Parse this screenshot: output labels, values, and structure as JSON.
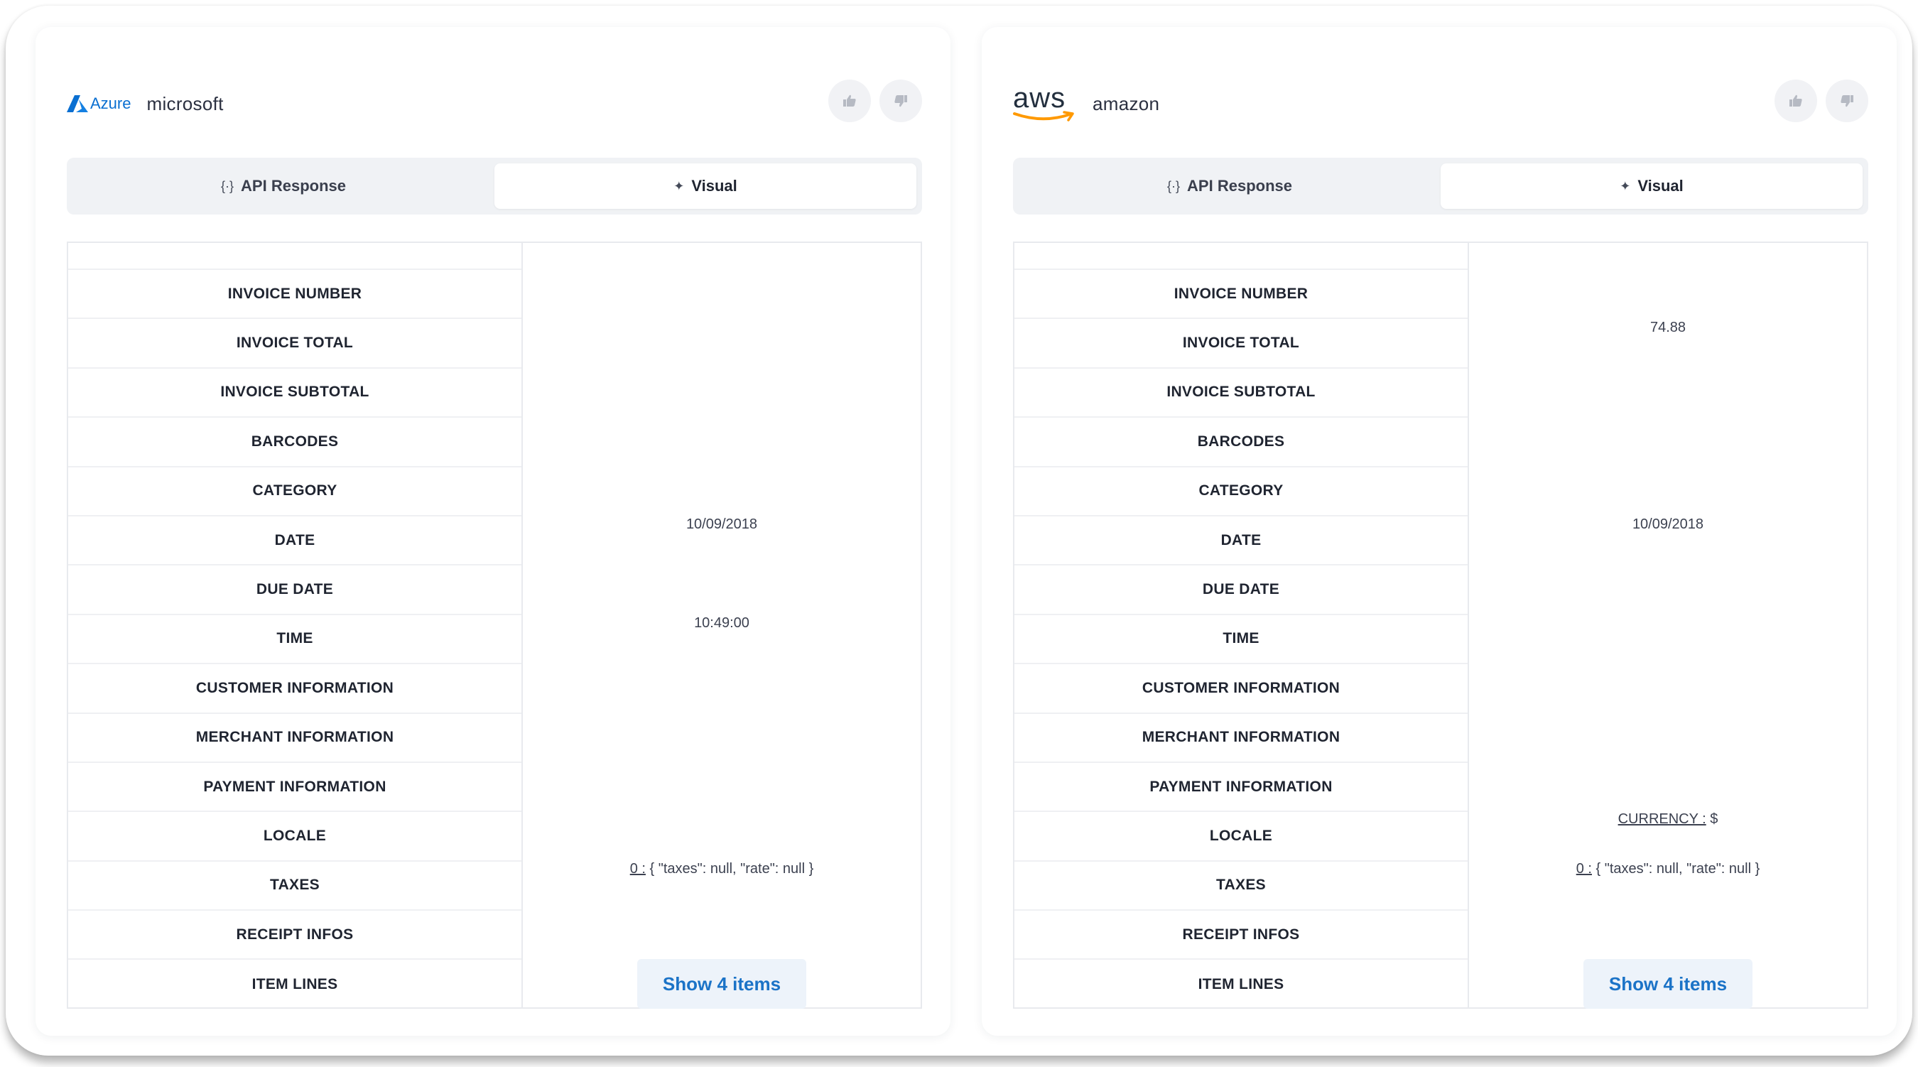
{
  "cards": [
    {
      "logo_text": "Azure",
      "provider": "microsoft",
      "tabs": {
        "api_response": "API Response",
        "visual": "Visual"
      },
      "fields": [
        "INVOICE NUMBER",
        "INVOICE TOTAL",
        "INVOICE SUBTOTAL",
        "BARCODES",
        "CATEGORY",
        "DATE",
        "DUE DATE",
        "TIME",
        "CUSTOMER INFORMATION",
        "MERCHANT INFORMATION",
        "PAYMENT INFORMATION",
        "LOCALE",
        "TAXES",
        "RECEIPT INFOS",
        "ITEM LINES"
      ],
      "values": {
        "date": "10/09/2018",
        "time": "10:49:00",
        "taxes_key": "0 :",
        "taxes_value": "{ \"taxes\": null, \"rate\": null }"
      },
      "show_items": "Show 4 items"
    },
    {
      "logo_text": "aws",
      "provider": "amazon",
      "tabs": {
        "api_response": "API Response",
        "visual": "Visual"
      },
      "fields": [
        "INVOICE NUMBER",
        "INVOICE TOTAL",
        "INVOICE SUBTOTAL",
        "BARCODES",
        "CATEGORY",
        "DATE",
        "DUE DATE",
        "TIME",
        "CUSTOMER INFORMATION",
        "MERCHANT INFORMATION",
        "PAYMENT INFORMATION",
        "LOCALE",
        "TAXES",
        "RECEIPT INFOS",
        "ITEM LINES"
      ],
      "values": {
        "invoice_total": "74.88",
        "date": "10/09/2018",
        "currency_key": "CURRENCY :",
        "currency_value": "$",
        "taxes_key": "0 :",
        "taxes_value": "{ \"taxes\": null, \"rate\": null }"
      },
      "show_items": "Show 4 items"
    }
  ],
  "colors": {
    "azure_blue": "#0a6fd1",
    "aws_orange": "#ff9900",
    "link_blue": "#1b73c7"
  }
}
